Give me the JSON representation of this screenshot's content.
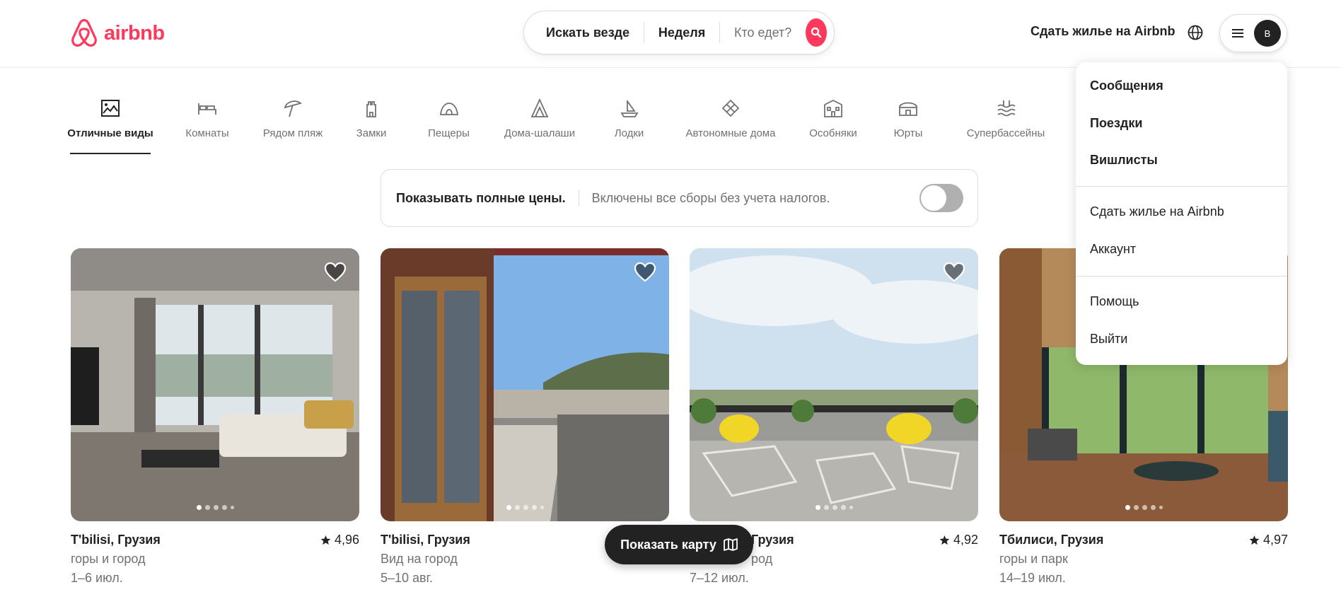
{
  "colors": {
    "brand": "#ff385c",
    "text": "#222222",
    "muted": "#717171",
    "border": "#dddddd"
  },
  "header": {
    "logo_text": "airbnb",
    "search": {
      "location": "Искать везде",
      "dates": "Неделя",
      "guests": "Кто едет?"
    },
    "host_link": "Сдать жилье на Airbnb",
    "avatar_initial": "B"
  },
  "categories": [
    {
      "label": "Отличные виды",
      "icon": "view-icon",
      "active": true
    },
    {
      "label": "Комнаты",
      "icon": "bed-icon"
    },
    {
      "label": "Рядом пляж",
      "icon": "umbrella-icon"
    },
    {
      "label": "Замки",
      "icon": "castle-icon"
    },
    {
      "label": "Пещеры",
      "icon": "cave-icon"
    },
    {
      "label": "Дома-шалаши",
      "icon": "a-frame-icon"
    },
    {
      "label": "Лодки",
      "icon": "boat-icon"
    },
    {
      "label": "Автономные дома",
      "icon": "off-grid-icon"
    },
    {
      "label": "Особняки",
      "icon": "mansion-icon"
    },
    {
      "label": "Юрты",
      "icon": "yurt-icon"
    },
    {
      "label": "Супербассейны",
      "icon": "pool-icon"
    }
  ],
  "price_toggle": {
    "title": "Показывать полные цены.",
    "description": "Включены все сборы без учета налогов.",
    "enabled": false
  },
  "listings": [
    {
      "title": "T'bilisi, Грузия",
      "rating": "4,96",
      "subtitle": "горы и город",
      "dates": "1–6 июл."
    },
    {
      "title": "T'bilisi, Грузия",
      "rating": "",
      "subtitle": "Вид на город",
      "dates": "5–10 авг."
    },
    {
      "title": "Грузия",
      "rating": "4,92",
      "subtitle": "род",
      "dates": "7–12 июл."
    },
    {
      "title": "Тбилиси, Грузия",
      "rating": "4,97",
      "subtitle": "горы и парк",
      "dates": "14–19 июл."
    }
  ],
  "map_button": {
    "label": "Показать карту",
    "icon": "map-icon"
  },
  "user_menu": {
    "items": [
      "Сообщения",
      "Поездки",
      "Вишлисты",
      "Сдать жилье на Airbnb",
      "Аккаунт",
      "Помощь",
      "Выйти"
    ]
  }
}
